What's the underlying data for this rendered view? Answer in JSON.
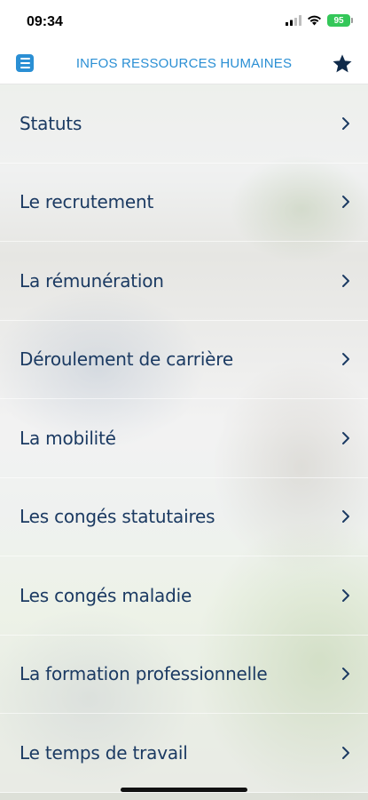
{
  "status_bar": {
    "time": "09:34",
    "battery_level": "95"
  },
  "nav": {
    "title": "INFOS RESSOURCES HUMAINES",
    "menu_icon": "menu-icon",
    "favorite_icon": "star-icon",
    "accent_color": "#2a8fd4"
  },
  "menu": {
    "items": [
      {
        "label": "Statuts"
      },
      {
        "label": "Le recrutement"
      },
      {
        "label": "La rémunération"
      },
      {
        "label": "Déroulement de carrière"
      },
      {
        "label": "La mobilité"
      },
      {
        "label": "Les congés statutaires"
      },
      {
        "label": "Les congés maladie"
      },
      {
        "label": "La formation professionnelle"
      },
      {
        "label": "Le temps de travail"
      }
    ]
  },
  "colors": {
    "label": "#1b3a62",
    "star": "#0f2a4a"
  }
}
